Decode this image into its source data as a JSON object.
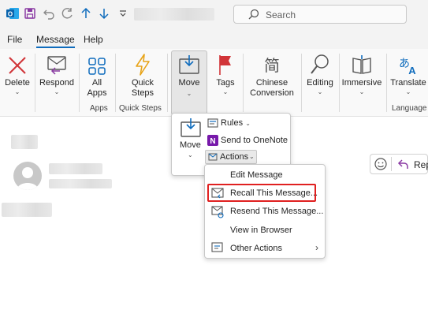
{
  "titlebar": {
    "search_placeholder": "Search",
    "icons": [
      "outlook-app-icon",
      "save-icon",
      "undo-icon",
      "redo-icon",
      "up-arrow-icon",
      "down-arrow-icon",
      "customize-toolbar-icon",
      "search-icon"
    ]
  },
  "menubar": {
    "items": [
      "File",
      "Message",
      "Help"
    ],
    "active": "Message"
  },
  "ribbon": {
    "buttons": {
      "delete": "Delete",
      "respond": "Respond",
      "all_apps": "All Apps",
      "quick_steps": "Quick Steps",
      "move": "Move",
      "tags": "Tags",
      "chinese_conversion": "Chinese Conversion",
      "editing": "Editing",
      "immersive": "Immersive",
      "translate": "Translate"
    },
    "groups": {
      "apps": "Apps",
      "quick_steps": "Quick Steps",
      "language": "Language"
    }
  },
  "move_menu": {
    "move_label": "Move",
    "rules": "Rules",
    "send_to_onenote": "Send to OneNote",
    "actions": "Actions"
  },
  "actions_menu": {
    "edit_message": "Edit Message",
    "recall_message": "Recall This Message...",
    "resend_message": "Resend This Message...",
    "view_in_browser": "View in Browser",
    "other_actions": "Other Actions"
  },
  "message": {
    "reply_label": "Rep"
  },
  "colors": {
    "accent": "#0f6cbd",
    "highlight": "#e02020",
    "delete": "#d13438"
  }
}
